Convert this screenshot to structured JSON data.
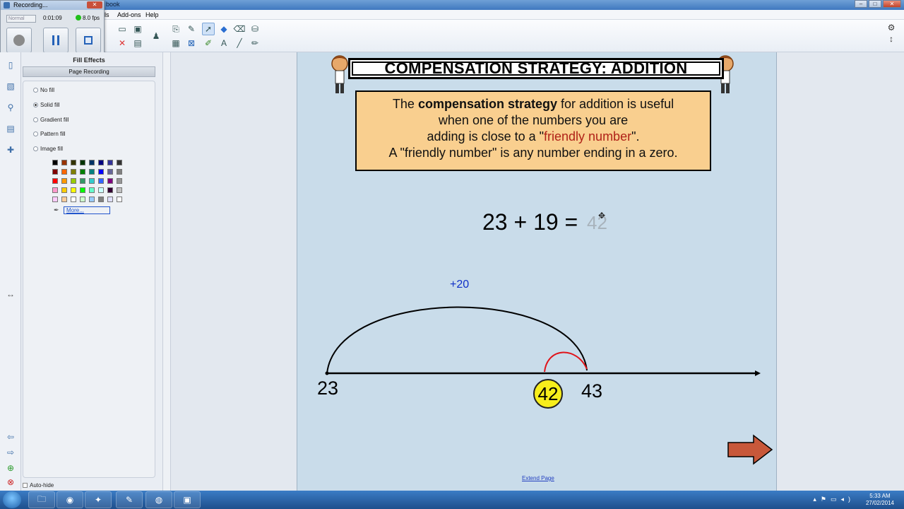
{
  "window": {
    "title": "book"
  },
  "menu": {
    "items": [
      "ls",
      "Add-ons",
      "Help"
    ]
  },
  "recorder": {
    "title": "Recording...",
    "close_glyph": "✕",
    "mode": "Normal",
    "time": "0:01:09",
    "fps": "8.0 fps"
  },
  "panel": {
    "heading": "Fill Effects",
    "page_recording_button": "Page Recording",
    "fill_options": [
      "No fill",
      "Solid fill",
      "Gradient fill",
      "Pattern fill",
      "Image fill"
    ],
    "selected_fill": "Solid fill",
    "more_link": "More...",
    "autohide_label": "Auto-hide",
    "palette_colors": [
      [
        "#000000",
        "#993300",
        "#333300",
        "#003300",
        "#003366",
        "#000080",
        "#333399",
        "#333333"
      ],
      [
        "#800000",
        "#ff6600",
        "#808000",
        "#008000",
        "#008080",
        "#0000ff",
        "#666699",
        "#808080"
      ],
      [
        "#ff0000",
        "#ff9900",
        "#99cc00",
        "#339966",
        "#33cccc",
        "#3366ff",
        "#800080",
        "#969696"
      ],
      [
        "#ff99cc",
        "#ffcc00",
        "#ffff00",
        "#00ff00",
        "#66ffcc",
        "#ccffff",
        "#330033",
        "#c0c0c0"
      ],
      [
        "#ffccff",
        "#ffcc99",
        "#ffffff",
        "#ccffcc",
        "#99ccff",
        "#808080",
        "#e0e0ff",
        "#ffffff"
      ]
    ]
  },
  "slide": {
    "title": "COMPENSATION STRATEGY: ADDITION",
    "info_lines": [
      {
        "pre": "The ",
        "bold": "compensation strategy",
        "post": " for addition is useful"
      },
      {
        "text": "when one of the numbers you are"
      },
      {
        "pre": "adding is close to a \"",
        "hl": "friendly number",
        "post": "\"."
      },
      {
        "text": "A \"friendly number\" is any number ending in a zero."
      }
    ],
    "equation": "23 + 19 =",
    "answer": "42",
    "jump_label": "+20",
    "start_number": "23",
    "end_number": "43",
    "circled_number": "42",
    "extend_link": "Extend Page",
    "arc_color_main": "#000000",
    "arc_color_back": "#e0141a",
    "arrow_color": "#c8583a"
  },
  "taskbar": {
    "time": "5:33 AM",
    "date": "27/02/2014"
  }
}
